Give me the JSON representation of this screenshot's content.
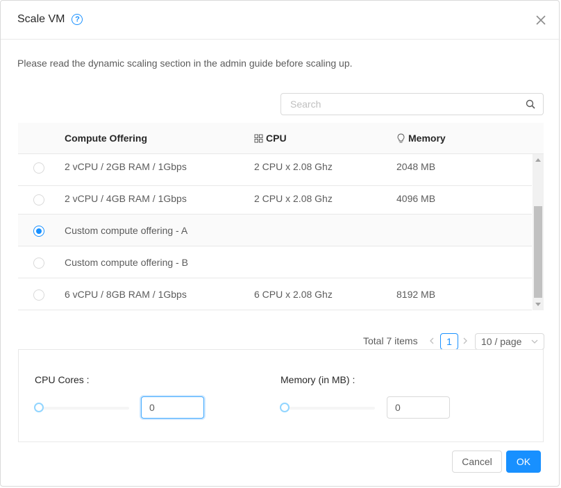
{
  "dialog": {
    "title": "Scale VM",
    "notice": "Please read the dynamic scaling section in the admin guide before scaling up."
  },
  "search": {
    "placeholder": "Search"
  },
  "table": {
    "columns": {
      "offering": "Compute Offering",
      "cpu": "CPU",
      "memory": "Memory"
    },
    "rows": [
      {
        "name": "2 vCPU / 2GB RAM / 1Gbps",
        "cpu": "2 CPU x 2.08 Ghz",
        "memory": "2048 MB",
        "selected": false
      },
      {
        "name": "2 vCPU / 4GB RAM / 1Gbps",
        "cpu": "2 CPU x 2.08 Ghz",
        "memory": "4096 MB",
        "selected": false
      },
      {
        "name": "Custom compute offering - A",
        "cpu": "",
        "memory": "",
        "selected": true
      },
      {
        "name": "Custom compute offering - B",
        "cpu": "",
        "memory": "",
        "selected": false
      },
      {
        "name": "6 vCPU / 8GB RAM / 1Gbps",
        "cpu": "6 CPU x 2.08 Ghz",
        "memory": "8192 MB",
        "selected": false
      }
    ]
  },
  "pagination": {
    "total": "Total 7 items",
    "current": "1",
    "page_size": "10 / page"
  },
  "custom": {
    "cpu_label": "CPU Cores :",
    "cpu_value": "0",
    "memory_label": "Memory (in MB) :",
    "memory_value": "0"
  },
  "buttons": {
    "cancel": "Cancel",
    "ok": "OK"
  },
  "colors": {
    "primary": "#1890ff",
    "border": "#d9d9d9",
    "header_bg": "#fafafa"
  }
}
